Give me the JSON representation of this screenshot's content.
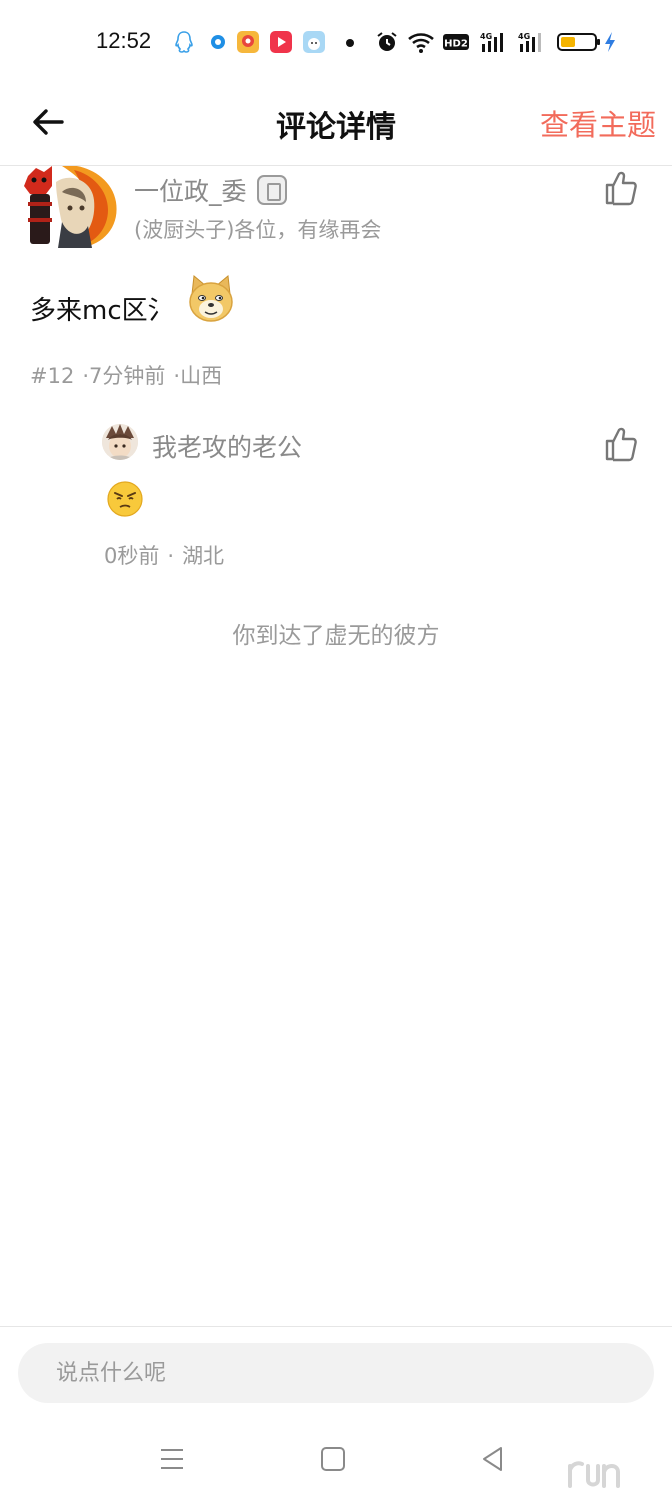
{
  "status_bar": {
    "time": "12:52",
    "icons": [
      "qq-icon",
      "circle-app-icon",
      "game-app-icon",
      "video-app-icon",
      "app-icon",
      "alarm-icon",
      "wifi-icon",
      "hd2-icon",
      "4g-signal-icon",
      "4g-signal-icon",
      "battery-icon",
      "charging-icon"
    ],
    "hd_label": "HD2",
    "net_label": "4G"
  },
  "header": {
    "back_icon": "back-arrow-icon",
    "title": "评论详情",
    "view_topic": "查看主题"
  },
  "comment": {
    "author": "一位政_委",
    "signature": "(波厨头子)各位，有缘再会",
    "text": "多来mc区氵",
    "floor": "#12",
    "time": "7分钟前",
    "location": "山西",
    "separator": "·"
  },
  "reply": {
    "author": "我老攻的老公",
    "time": "0秒前",
    "location": "湖北",
    "separator": "·"
  },
  "end_message": "你到达了虚无的彼方",
  "input": {
    "placeholder": "说点什么呢"
  },
  "colors": {
    "accent": "#f26b5b",
    "muted_text": "#9a9a9a",
    "input_bg": "#f2f2f2"
  }
}
